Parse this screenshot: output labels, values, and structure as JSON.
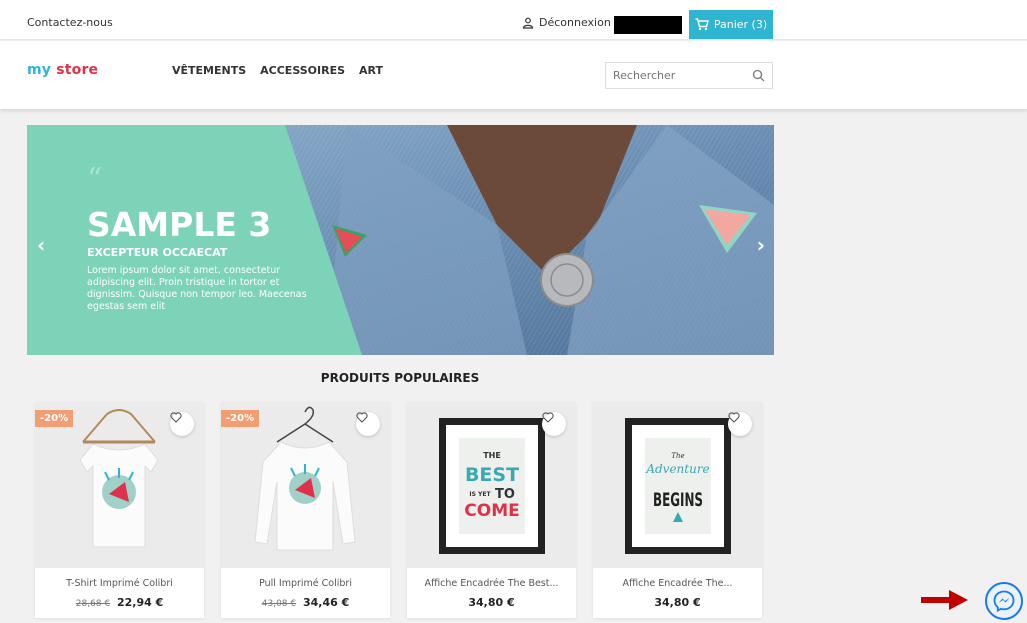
{
  "topbar": {
    "contact": "Contactez-nous",
    "logout": "Déconnexion",
    "cart_label": "Panier (3)"
  },
  "header": {
    "logo": {
      "my": "my",
      "store": "store"
    },
    "nav": [
      "VÊTEMENTS",
      "ACCESSOIRES",
      "ART"
    ],
    "search_placeholder": "Rechercher"
  },
  "slider": {
    "quote_mark": "“",
    "title": "SAMPLE 3",
    "subtitle": "EXCEPTEUR OCCAECAT",
    "description": "Lorem ipsum dolor sit amet, consectetur adipiscing elit. Proin tristique in tortor et dignissim. Quisque non tempor leo. Maecenas egestas sem elit",
    "prev": "‹",
    "next": "›"
  },
  "section": {
    "title": "PRODUITS POPULAIRES"
  },
  "products": [
    {
      "name": "T-Shirt Imprimé Colibri",
      "old_price": "28,68 €",
      "price": "22,94 €",
      "flag": "-20%"
    },
    {
      "name": "Pull Imprimé Colibri",
      "old_price": "43,08 €",
      "price": "34,46 €",
      "flag": "-20%"
    },
    {
      "name": "Affiche Encadrée The Best...",
      "old_price": "",
      "price": "34,80 €",
      "flag": ""
    },
    {
      "name": "Affiche Encadrée The...",
      "old_price": "",
      "price": "34,80 €",
      "flag": ""
    }
  ],
  "posters": {
    "best": {
      "the": "THE",
      "best": "BEST",
      "is_yet": "IS YET",
      "to": "TO",
      "come": "COME"
    },
    "adventure": {
      "the": "The",
      "adventure": "Adventure",
      "begins": "BEGINS"
    }
  },
  "colors": {
    "accent": "#2fb5d2",
    "mint": "#7dd3b8",
    "flag": "#f39d72",
    "messenger": "#1877f2",
    "arrow": "#c00000"
  },
  "icons": {
    "user": "user-icon",
    "cart": "cart-icon",
    "search": "search-icon",
    "wishlist": "heart-icon",
    "messenger": "messenger-icon"
  }
}
